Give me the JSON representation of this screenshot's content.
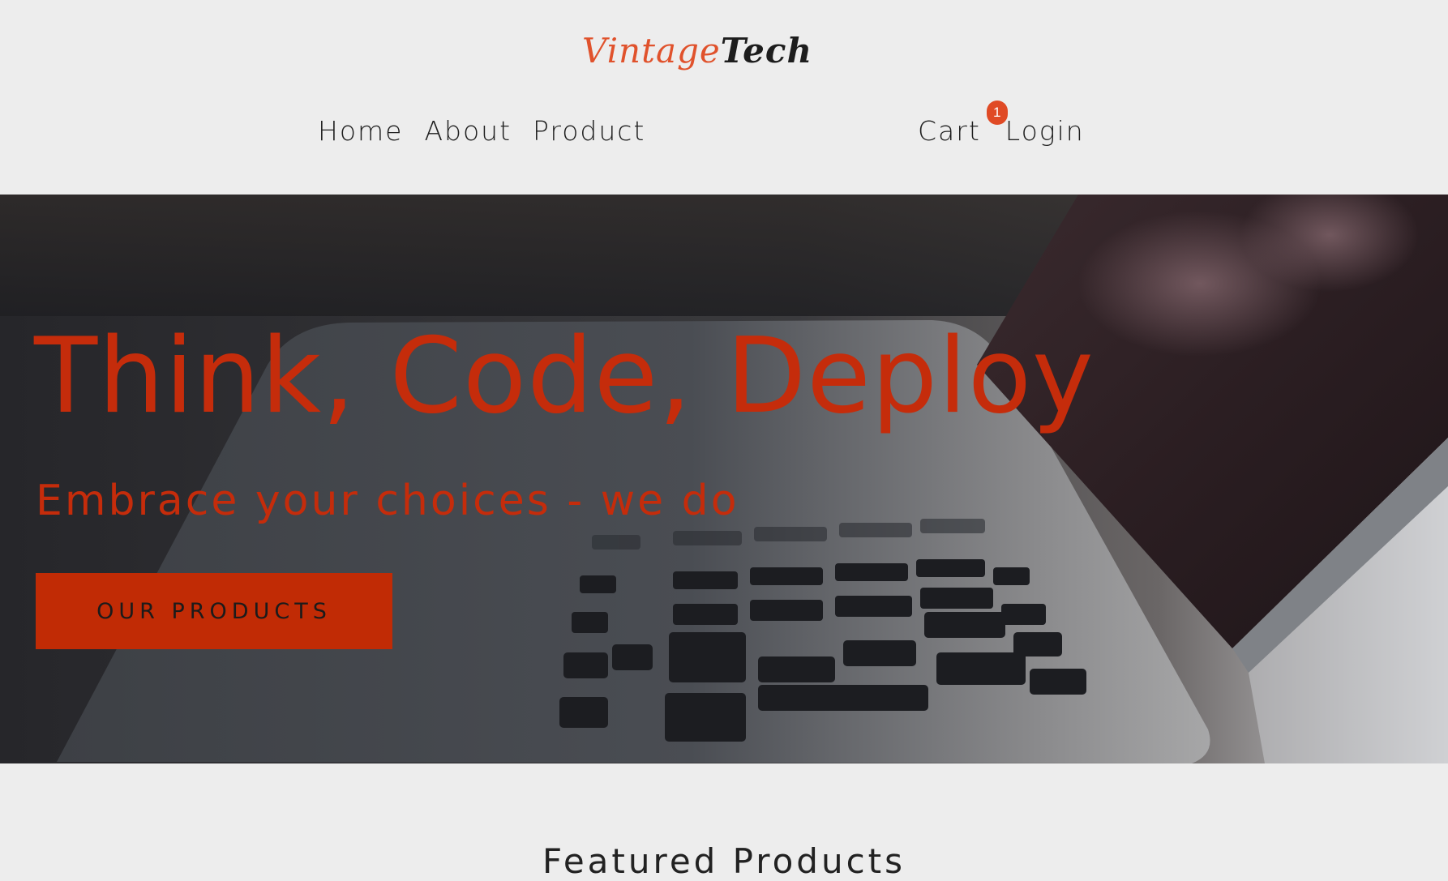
{
  "header": {
    "logo_part1": "Vintage",
    "logo_part2": "Tech",
    "nav_left": [
      "Home",
      "About",
      "Product"
    ],
    "cart_label": "Cart",
    "cart_count": "1",
    "login_label": "Login"
  },
  "hero": {
    "title": "Think, Code, Deploy",
    "subtitle": "Embrace your choices - we do",
    "button_label": "OUR PRODUCTS",
    "image": "laptop-keyboard-photo"
  },
  "featured": {
    "title": "Featured Products"
  },
  "colors": {
    "accent": "#c52c0b",
    "logo_orange": "#e0522c",
    "background": "#ededed",
    "badge": "#e04a25"
  }
}
